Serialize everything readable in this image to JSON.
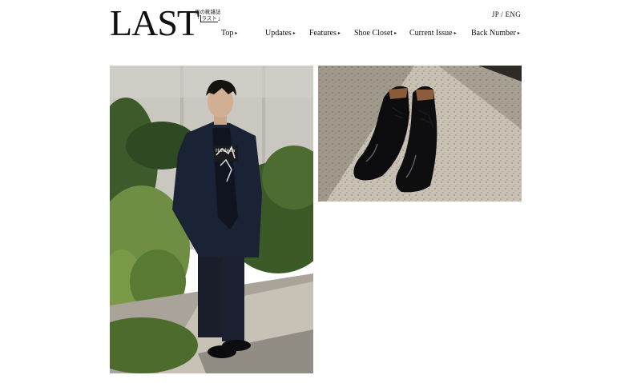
{
  "header": {
    "logo_text": "LAST",
    "logo_sub_top": "男の靴雑誌",
    "logo_sub_bottom": "ラスト",
    "lang_switch": "JP / ENG"
  },
  "nav": {
    "items": [
      {
        "label": "Top"
      },
      {
        "label": "Updates"
      },
      {
        "label": "Features"
      },
      {
        "label": "Shoe Closet"
      },
      {
        "label": "Current Issue"
      },
      {
        "label": "Back Number"
      }
    ],
    "arrow": "▸"
  },
  "photos": {
    "person_shirt_text": "Haldeka"
  },
  "colors": {
    "background": "#ffffff",
    "text": "#111111"
  }
}
